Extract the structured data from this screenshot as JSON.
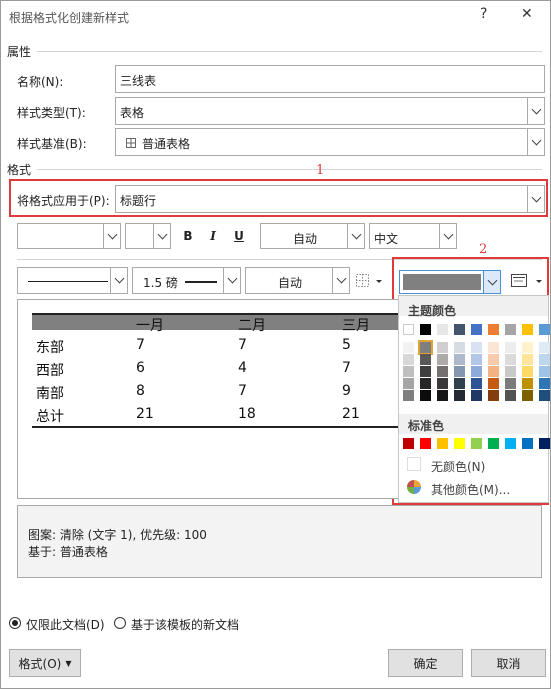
{
  "window": {
    "title": "根据格式化创建新样式",
    "help": "?",
    "close": "✕"
  },
  "properties": {
    "section": "属性",
    "name_label": "名称(N):",
    "name_value": "三线表",
    "type_label": "样式类型(T):",
    "type_value": "表格",
    "base_label": "样式基准(B):",
    "base_value": "普通表格"
  },
  "format": {
    "section": "格式",
    "apply_label": "将格式应用于(P):",
    "apply_value": "标题行",
    "font_value": "",
    "size_value": "",
    "bold": "B",
    "italic": "I",
    "underline": "U",
    "font_color": "自动",
    "script": "中文",
    "line_weight": "1.5 磅",
    "border_color": "自动",
    "shading_color": "#808080"
  },
  "annotations": {
    "one": "1",
    "two": "2"
  },
  "preview": {
    "headers": [
      "",
      "一月",
      "二月",
      "三月"
    ],
    "rows": [
      [
        "东部",
        "7",
        "7",
        "5"
      ],
      [
        "西部",
        "6",
        "4",
        "7"
      ],
      [
        "南部",
        "8",
        "7",
        "9"
      ],
      [
        "总计",
        "21",
        "18",
        "21"
      ]
    ]
  },
  "palette": {
    "theme_title": "主题颜色",
    "theme_top": [
      "#ffffff",
      "#000000",
      "#e7e6e6",
      "#44546a",
      "#4472c4",
      "#ed7d31",
      "#a5a5a5",
      "#ffc000",
      "#5b9bd5"
    ],
    "theme_shades": [
      [
        "#f2f2f2",
        "#7f7f7f",
        "#d0cece",
        "#d6dce4",
        "#d9e2f3",
        "#fbe5d5",
        "#ededed",
        "#fff2cc",
        "#deebf6"
      ],
      [
        "#d8d8d8",
        "#595959",
        "#aeaaaa",
        "#adb9ca",
        "#b4c6e7",
        "#f7cbac",
        "#dbdbdb",
        "#fee599",
        "#bdd7ee"
      ],
      [
        "#bfbfbf",
        "#3f3f3f",
        "#757070",
        "#8496b0",
        "#8eaadb",
        "#f4b183",
        "#c9c9c9",
        "#ffd965",
        "#9dc3e6"
      ],
      [
        "#a5a5a5",
        "#262626",
        "#3a3838",
        "#323f4f",
        "#2f5496",
        "#c55a11",
        "#7b7b7b",
        "#bf9000",
        "#2e75b5"
      ],
      [
        "#7f7f7f",
        "#0c0c0c",
        "#171616",
        "#222a35",
        "#1f3864",
        "#833c0b",
        "#525252",
        "#7f6000",
        "#1e4e79"
      ]
    ],
    "standard_title": "标准色",
    "standard": [
      "#c00000",
      "#ff0000",
      "#ffc000",
      "#ffff00",
      "#92d050",
      "#00b050",
      "#00b0f0",
      "#0070c0",
      "#002060"
    ],
    "no_color": "无颜色(N)",
    "more_colors": "其他颜色(M)..."
  },
  "description": {
    "line1": "图案: 清除 (文字 1), 优先级: 100",
    "line2": "基于: 普通表格"
  },
  "scope": {
    "this_doc": "仅限此文档(D)",
    "template": "基于该模板的新文档"
  },
  "buttons": {
    "format": "格式(O)",
    "ok": "确定",
    "cancel": "取消"
  }
}
